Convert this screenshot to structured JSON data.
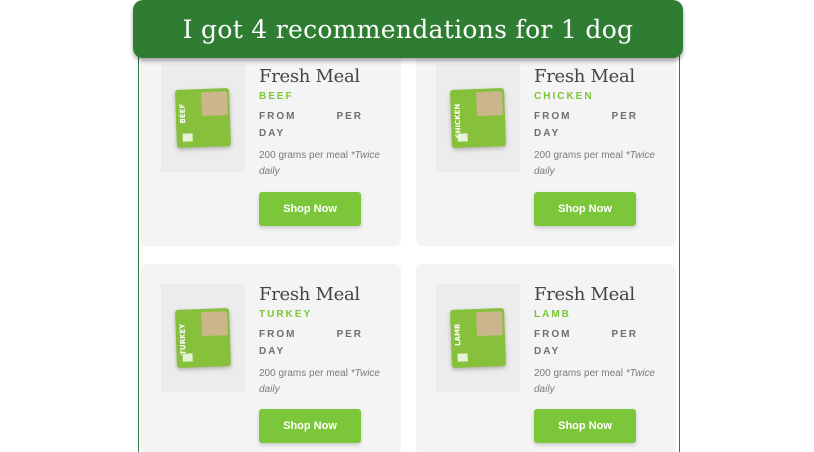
{
  "banner": {
    "text": "I got 4 recommendations for 1 dog"
  },
  "cards": [
    {
      "title": "Fresh Meal",
      "flavor": "BEEF",
      "from": "FROM",
      "per": "PER",
      "day": "DAY",
      "portion": "200 grams per meal",
      "note": "*Twice daily",
      "button": "Shop Now",
      "pack_label": "BEEF"
    },
    {
      "title": "Fresh Meal",
      "flavor": "CHICKEN",
      "from": "FROM",
      "per": "PER",
      "day": "DAY",
      "portion": "200 grams per meal",
      "note": "*Twice daily",
      "button": "Shop Now",
      "pack_label": "CHICKEN"
    },
    {
      "title": "Fresh Meal",
      "flavor": "TURKEY",
      "from": "FROM",
      "per": "PER",
      "day": "DAY",
      "portion": "200 grams per meal",
      "note": "*Twice daily",
      "button": "Shop Now",
      "pack_label": "TURKEY"
    },
    {
      "title": "Fresh Meal",
      "flavor": "LAMB",
      "from": "FROM",
      "per": "PER",
      "day": "DAY",
      "portion": "200 grams per meal",
      "note": "*Twice daily",
      "button": "Shop Now",
      "pack_label": "LAMB"
    }
  ],
  "colors": {
    "banner": "#2e7d32",
    "accent": "#7cc63a",
    "card_bg": "#f4f4f4"
  }
}
